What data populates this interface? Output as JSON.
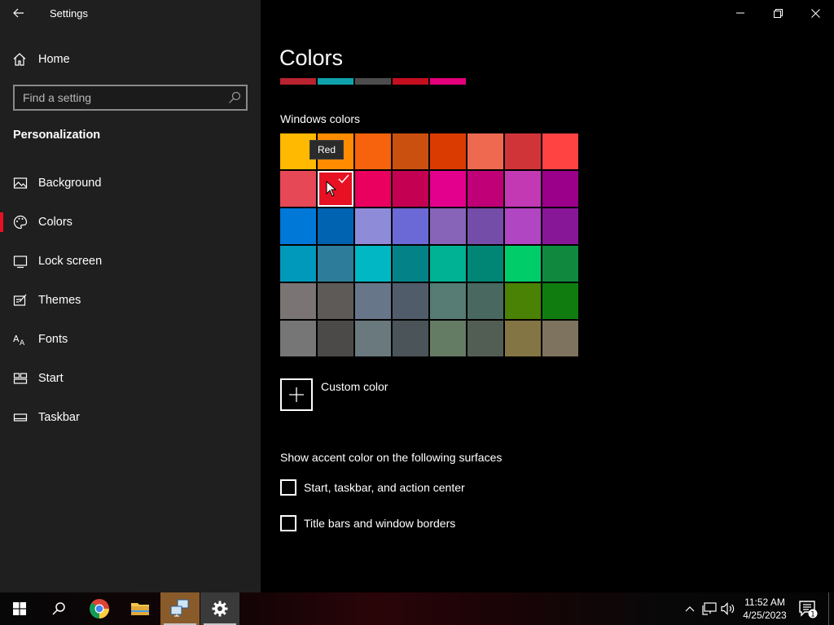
{
  "window": {
    "title": "Settings"
  },
  "nav": {
    "home": "Home",
    "search_placeholder": "Find a setting",
    "section": "Personalization",
    "items": [
      {
        "label": "Background",
        "icon": "picture-icon"
      },
      {
        "label": "Colors",
        "icon": "palette-icon",
        "active": true
      },
      {
        "label": "Lock screen",
        "icon": "lock-screen-icon"
      },
      {
        "label": "Themes",
        "icon": "themes-icon"
      },
      {
        "label": "Fonts",
        "icon": "fonts-icon"
      },
      {
        "label": "Start",
        "icon": "start-icon"
      },
      {
        "label": "Taskbar",
        "icon": "taskbar-icon"
      }
    ]
  },
  "main": {
    "title": "Colors",
    "recent_colors": [
      "#b8232f",
      "#10a2ac",
      "#4c4c4c",
      "#c50e1f",
      "#e3007c"
    ],
    "windows_colors_label": "Windows colors",
    "tooltip": "Red",
    "selected_swatch_index": 9,
    "swatches": [
      "#ffb900",
      "#ff8c00",
      "#f7630c",
      "#ca5010",
      "#da3b01",
      "#ef6950",
      "#d13438",
      "#ff4343",
      "#e74856",
      "#e81123",
      "#ea005e",
      "#c30052",
      "#e3008c",
      "#bf0077",
      "#c239b3",
      "#9a0089",
      "#0078d7",
      "#0063b1",
      "#8e8cd8",
      "#6b69d6",
      "#8764b8",
      "#744da9",
      "#b146c2",
      "#881798",
      "#0099bc",
      "#2d7d9a",
      "#00b7c3",
      "#038387",
      "#00b294",
      "#018574",
      "#00cc6a",
      "#10893e",
      "#7a7574",
      "#5d5a58",
      "#68768a",
      "#515c6b",
      "#567c73",
      "#486860",
      "#498205",
      "#107c10",
      "#767676",
      "#4c4a48",
      "#69797e",
      "#4a5459",
      "#647c64",
      "#525e54",
      "#847545",
      "#7e735f"
    ],
    "custom_color_label": "Custom color",
    "surfaces_label": "Show accent color on the following surfaces",
    "checkboxes": [
      {
        "label": "Start, taskbar, and action center",
        "checked": false
      },
      {
        "label": "Title bars and window borders",
        "checked": false
      }
    ]
  },
  "taskbar": {
    "time": "11:52 AM",
    "date": "4/25/2023",
    "notification_count": "1",
    "apps": [
      "start-button",
      "search-button",
      "chrome",
      "file-explorer",
      "virtual-machine-app",
      "settings"
    ]
  }
}
